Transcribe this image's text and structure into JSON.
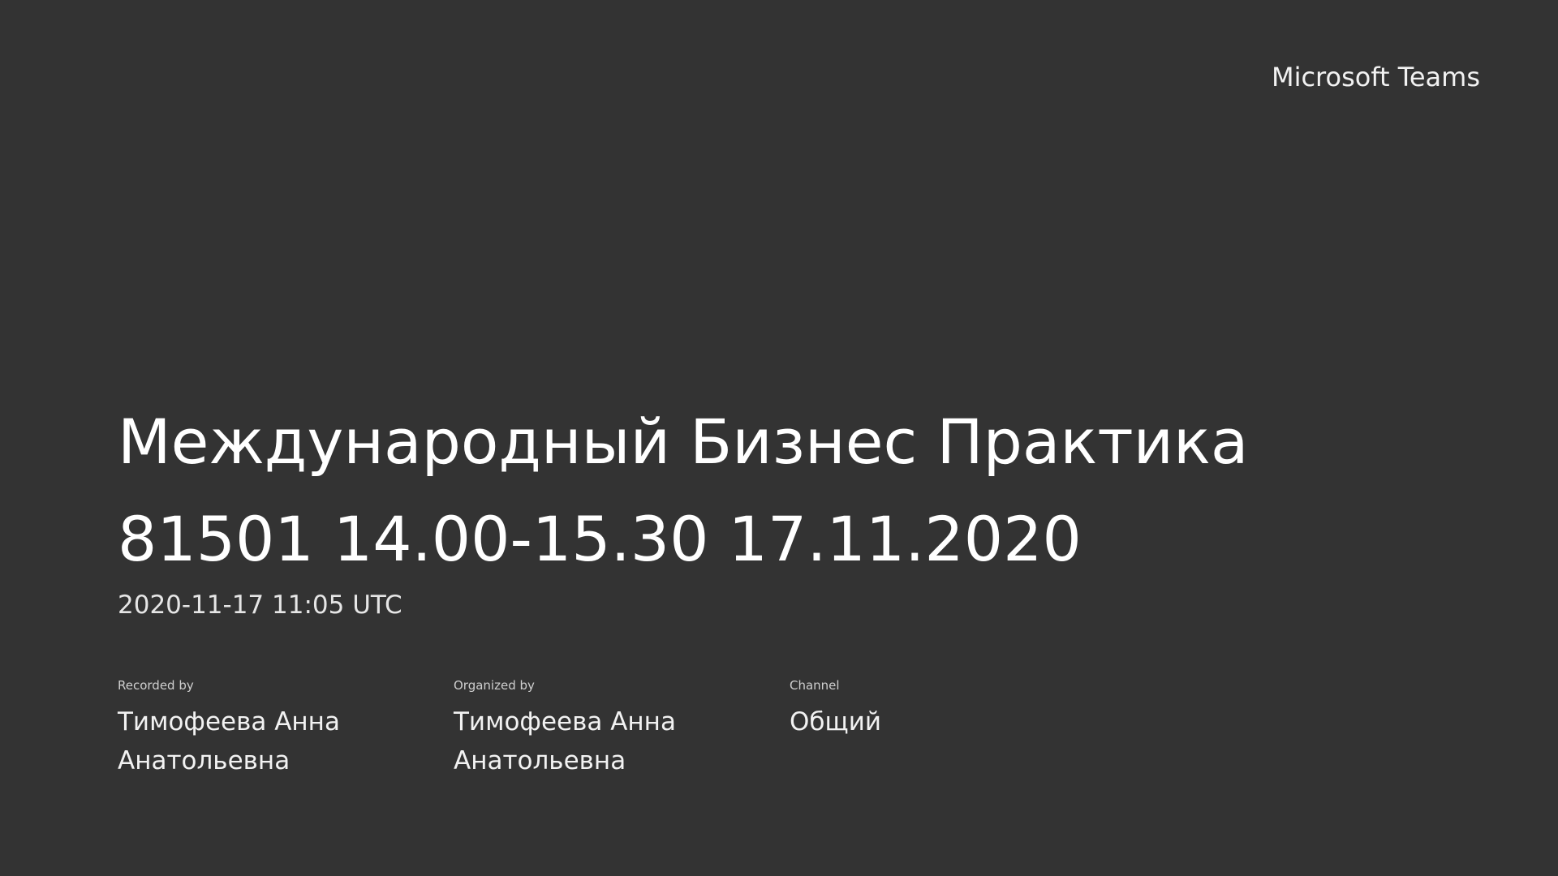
{
  "brand": "Microsoft Teams",
  "meeting": {
    "title": "Международный Бизнес Практика 81501 14.00-15.30 17.11.2020",
    "datetime": "2020-11-17 11:05 UTC"
  },
  "meta": [
    {
      "label": "Recorded by",
      "value": "Тимофеева Анна Анатольевна"
    },
    {
      "label": "Organized by",
      "value": "Тимофеева Анна Анатольевна"
    },
    {
      "label": "Channel",
      "value": "Общий"
    }
  ]
}
